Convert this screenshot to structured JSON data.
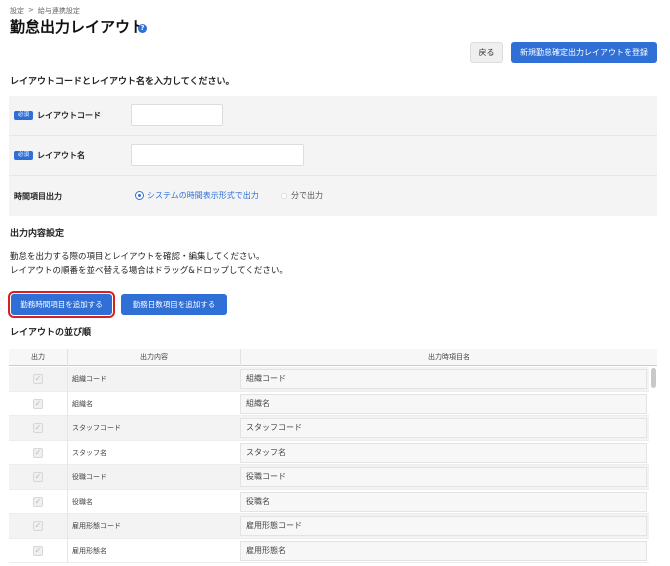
{
  "breadcrumb": {
    "items": [
      "設定",
      "給与連携設定"
    ],
    "separator": ">"
  },
  "page": {
    "title": "勤怠出力レイアウト",
    "help_icon": "?"
  },
  "header_actions": {
    "back_label": "戻る",
    "register_label": "新規勤怠確定出力レイアウトを登録"
  },
  "layout_form": {
    "heading": "レイアウトコードとレイアウト名を入力してください。",
    "required_badge": "必須",
    "code_label": "レイアウトコード",
    "code_value": "",
    "name_label": "レイアウト名",
    "name_value": "",
    "time_output_label": "時間項目出力",
    "time_options": [
      {
        "label": "システムの時間表示形式で出力",
        "selected": true
      },
      {
        "label": "分で出力",
        "selected": false
      }
    ]
  },
  "output_settings": {
    "heading": "出力内容設定",
    "desc_line1": "勤怠を出力する際の項目とレイアウトを確認・編集してください。",
    "desc_line2": "レイアウトの順番を並べ替える場合はドラッグ&ドロップしてください。",
    "add_time_button": "勤務時間項目を追加する",
    "add_days_button": "勤務日数項目を追加する"
  },
  "order": {
    "heading": "レイアウトの並び順",
    "columns": [
      "出力",
      "出力内容",
      "出力時項目名"
    ],
    "rows": [
      {
        "content": "組織コード",
        "name": "組織コード",
        "checked": true
      },
      {
        "content": "組織名",
        "name": "組織名",
        "checked": true
      },
      {
        "content": "スタッフコード",
        "name": "スタッフコード",
        "checked": true
      },
      {
        "content": "スタッフ名",
        "name": "スタッフ名",
        "checked": true
      },
      {
        "content": "役職コード",
        "name": "役職コード",
        "checked": true
      },
      {
        "content": "役職名",
        "name": "役職名",
        "checked": true
      },
      {
        "content": "雇用形態コード",
        "name": "雇用形態コード",
        "checked": true
      },
      {
        "content": "雇用形態名",
        "name": "雇用形態名",
        "checked": true
      }
    ]
  },
  "colors": {
    "accent": "#2f6fd6",
    "highlight_outline": "#d92020"
  }
}
